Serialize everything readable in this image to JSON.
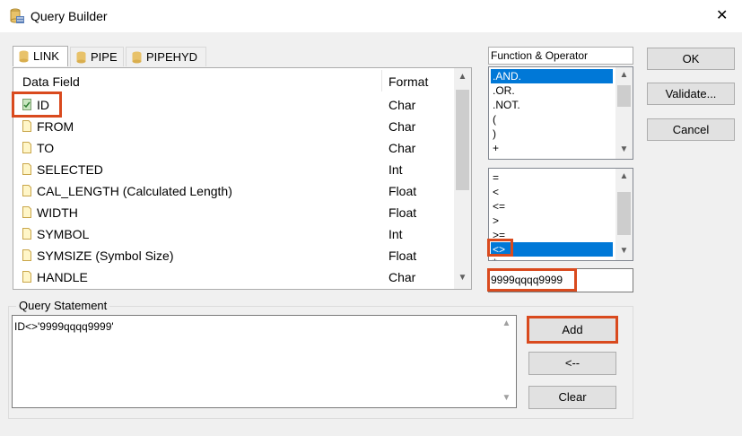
{
  "window": {
    "title": "Query Builder",
    "close_glyph": "✕"
  },
  "tabs": [
    {
      "label": "LINK",
      "icon": "database-icon"
    },
    {
      "label": "PIPE",
      "icon": "database-icon"
    },
    {
      "label": "PIPEHYD",
      "icon": "database-icon"
    }
  ],
  "fields": {
    "header_field": "Data Field",
    "header_format": "Format",
    "rows": [
      {
        "name": "ID",
        "format": "Char",
        "checked": true
      },
      {
        "name": "FROM",
        "format": "Char"
      },
      {
        "name": "TO",
        "format": "Char"
      },
      {
        "name": "SELECTED",
        "format": "Int"
      },
      {
        "name": "CAL_LENGTH (Calculated Length)",
        "format": "Float"
      },
      {
        "name": "WIDTH",
        "format": "Float"
      },
      {
        "name": "SYMBOL",
        "format": "Int"
      },
      {
        "name": "SYMSIZE (Symbol Size)",
        "format": "Float"
      },
      {
        "name": "HANDLE",
        "format": "Char"
      }
    ]
  },
  "function_operator": {
    "label": "Function & Operator",
    "logical": [
      ".AND.",
      ".OR.",
      ".NOT.",
      "(",
      ")",
      "+"
    ],
    "comparison": [
      "=",
      "<",
      "<=",
      ">",
      ">=",
      "<>",
      "*"
    ],
    "value_input": "9999qqqq9999"
  },
  "query": {
    "label": "Query Statement",
    "text": "ID<>'9999qqqq9999'"
  },
  "buttons": {
    "ok": "OK",
    "validate": "Validate...",
    "cancel": "Cancel",
    "add": "Add",
    "backspace": "<--",
    "clear": "Clear"
  },
  "colors": {
    "selection": "#0078d7",
    "highlight_box": "#d94a1e"
  }
}
